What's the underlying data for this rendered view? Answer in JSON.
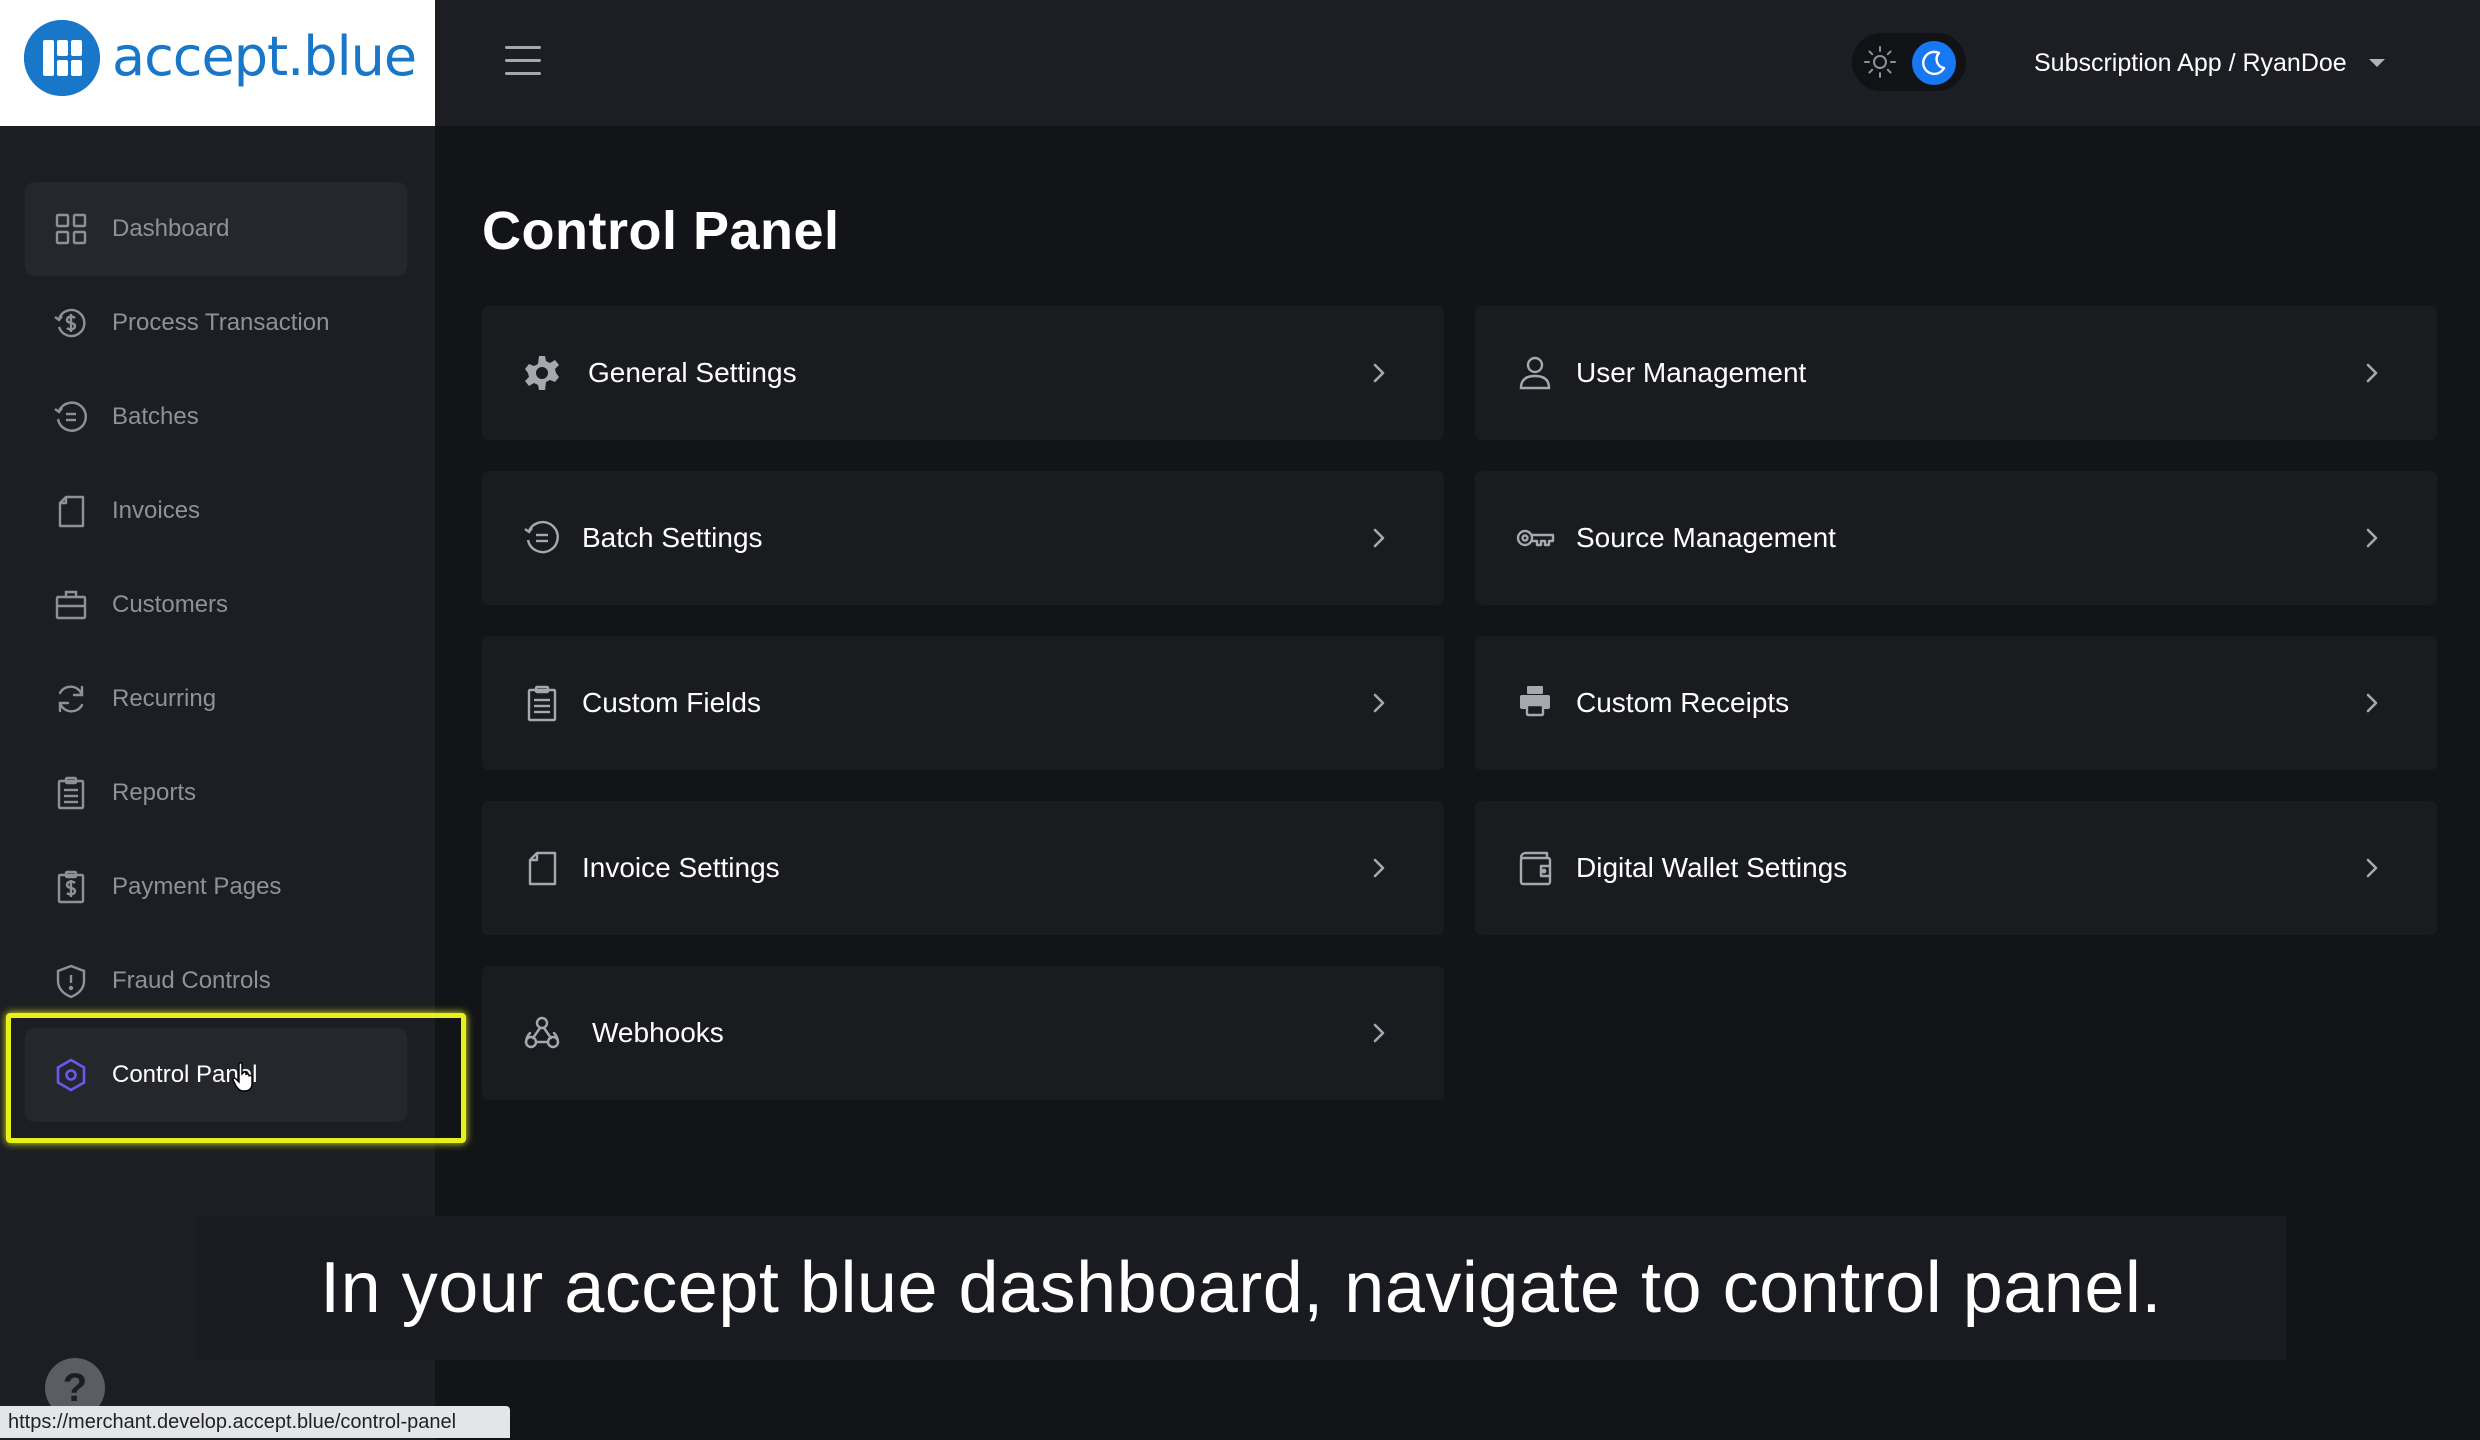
{
  "brand": {
    "name": "accept.blue",
    "color": "#1877c9"
  },
  "header": {
    "menu_icon": "hamburger-icon",
    "theme_light_icon": "sun-icon",
    "theme_dark_icon": "moon-icon",
    "theme_selected": "dark",
    "account_label": "Subscription App / RyanDoe"
  },
  "sidebar": {
    "items": [
      {
        "label": "Dashboard",
        "icon": "grid-icon"
      },
      {
        "label": "Process Transaction",
        "icon": "dollar-circle-icon"
      },
      {
        "label": "Batches",
        "icon": "batch-icon"
      },
      {
        "label": "Invoices",
        "icon": "invoice-icon"
      },
      {
        "label": "Customers",
        "icon": "briefcase-icon"
      },
      {
        "label": "Recurring",
        "icon": "refresh-icon"
      },
      {
        "label": "Reports",
        "icon": "clipboard-icon"
      },
      {
        "label": "Payment Pages",
        "icon": "payment-page-icon"
      },
      {
        "label": "Fraud Controls",
        "icon": "shield-icon"
      },
      {
        "label": "Control Panel",
        "icon": "hexagon-icon"
      }
    ],
    "active": "Control Panel",
    "help_label": "?"
  },
  "main": {
    "title": "Control Panel",
    "cards_left": [
      {
        "label": "General Settings",
        "icon": "gear-icon"
      },
      {
        "label": "Batch Settings",
        "icon": "batch-icon"
      },
      {
        "label": "Custom Fields",
        "icon": "clipboard-icon"
      },
      {
        "label": "Invoice Settings",
        "icon": "invoice-icon"
      },
      {
        "label": "Webhooks",
        "icon": "webhook-icon"
      }
    ],
    "cards_right": [
      {
        "label": "User Management",
        "icon": "user-icon"
      },
      {
        "label": "Source Management",
        "icon": "key-icon"
      },
      {
        "label": "Custom Receipts",
        "icon": "printer-icon"
      },
      {
        "label": "Digital Wallet Settings",
        "icon": "wallet-icon"
      }
    ]
  },
  "caption": "In your accept blue dashboard, navigate to control panel.",
  "status_url": "https://merchant.develop.accept.blue/control-panel",
  "colors": {
    "background": "#131418",
    "panel": "#1d1e23",
    "card": "#1a1b1f",
    "accent": "#1877f2",
    "active_icon": "#6e56f0",
    "highlight": "#e7f01a"
  }
}
